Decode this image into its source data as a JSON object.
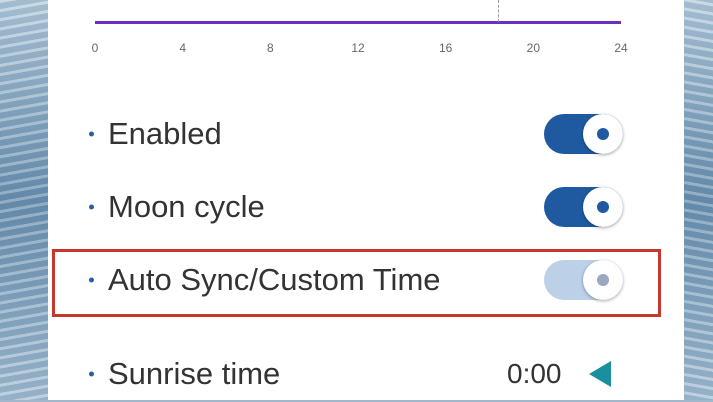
{
  "chart": {
    "x_ticks": [
      "0",
      "4",
      "8",
      "12",
      "16",
      "20",
      "24"
    ]
  },
  "chart_data": {
    "type": "line",
    "x_ticks": [
      0,
      4,
      8,
      12,
      16,
      20,
      24
    ],
    "xlim": [
      0,
      24
    ],
    "marker_x": 18.4,
    "line_color": "#6a2fc0"
  },
  "settings": {
    "enabled": {
      "label": "Enabled",
      "on": true
    },
    "moon_cycle": {
      "label": "Moon cycle",
      "on": true
    },
    "auto_sync": {
      "label": "Auto Sync/Custom Time",
      "on": false
    },
    "sunrise": {
      "label": "Sunrise time",
      "value": "0:00"
    }
  },
  "colors": {
    "toggle_on": "#1f5aa0",
    "toggle_off": "#bcd0e8",
    "highlight": "#c8372d",
    "arrow": "#1a8f9f"
  }
}
